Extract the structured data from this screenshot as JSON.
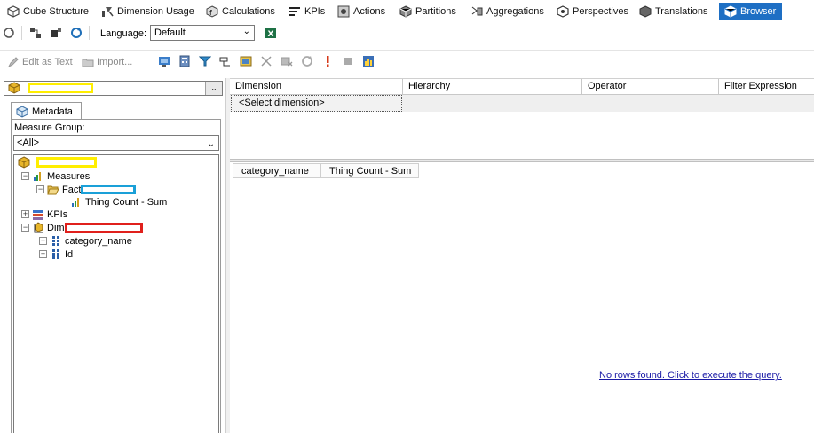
{
  "tabs": [
    {
      "label": "Cube Structure",
      "icon": "cube-structure-icon"
    },
    {
      "label": "Dimension Usage",
      "icon": "dimension-usage-icon"
    },
    {
      "label": "Calculations",
      "icon": "calculations-icon"
    },
    {
      "label": "KPIs",
      "icon": "kpis-icon"
    },
    {
      "label": "Actions",
      "icon": "actions-icon"
    },
    {
      "label": "Partitions",
      "icon": "partitions-icon"
    },
    {
      "label": "Aggregations",
      "icon": "aggregations-icon"
    },
    {
      "label": "Perspectives",
      "icon": "perspectives-icon"
    },
    {
      "label": "Translations",
      "icon": "translations-icon"
    },
    {
      "label": "Browser",
      "icon": "browser-icon",
      "active": true
    }
  ],
  "toolbar2": {
    "language_label": "Language:",
    "language_value": "Default"
  },
  "toolbar3": {
    "edit_as_text": "Edit as Text",
    "import": "Import..."
  },
  "left": {
    "cube_dots": "..",
    "metadata_tab": "Metadata",
    "measure_group_label": "Measure Group:",
    "measure_group_value": "<All>",
    "tree": {
      "measures": "Measures",
      "fact": "Fact",
      "thing_count": "Thing Count - Sum",
      "kpis": "KPIs",
      "dim": "Dim",
      "category_name": "category_name",
      "id": "Id"
    }
  },
  "filter": {
    "headers": [
      "Dimension",
      "Hierarchy",
      "Operator",
      "Filter Expression"
    ],
    "select_dimension": "<Select dimension>"
  },
  "results": {
    "headers": [
      "category_name",
      "Thing Count - Sum"
    ],
    "no_rows": "No rows found. Click to execute the query."
  },
  "colors": {
    "active_tab": "#1e6fc4",
    "redaction_yellow": "#ffee00",
    "redaction_blue": "#1aa0d8",
    "redaction_red": "#e0201c",
    "link": "#1a1aa6"
  }
}
